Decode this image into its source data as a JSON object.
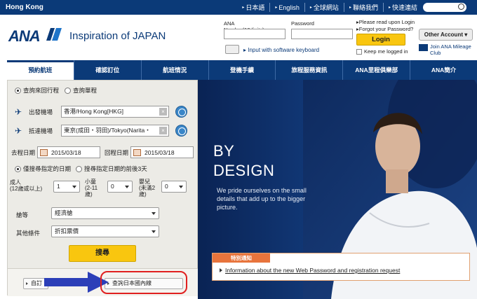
{
  "topbar": {
    "region": "Hong Kong",
    "links": [
      "日本語",
      "English",
      "全球網站",
      "聯絡我們",
      "快速連結"
    ]
  },
  "brand": {
    "logo": "ANA",
    "tagline": "Inspiration of JAPAN"
  },
  "login": {
    "ana_number_label": "ANA Number(10digits)",
    "password_label": "Password",
    "keyboard_link": "Input with software keyboard",
    "please_read": "Please read upon Login",
    "forgot": "Forgot your Password?",
    "login_button": "Login",
    "keep_logged_in": "Keep me logged in",
    "other_account": "Other Account",
    "join": "Join ANA Mileage Club"
  },
  "nav": [
    "預約航班",
    "確認訂位",
    "航班情況",
    "登機手續",
    "旅程服務資訊",
    "ANA里程俱樂部",
    "ANA簡介"
  ],
  "booking": {
    "trip_types": [
      "查詢來回行程",
      "查詢單程"
    ],
    "departure_label": "出發機場",
    "departure_value": "香港/Hong Kong[HKG]",
    "arrival_label": "抵達機場",
    "arrival_value": "東京(成田・羽田)/Tokyo(Narita・",
    "depart_date_label": "去程日期",
    "depart_date": "2015/03/18",
    "return_date_label": "回程日期",
    "return_date": "2015/03/18",
    "date_options": [
      "僅搜尋指定的日期",
      "搜尋指定日期的前後3天"
    ],
    "adult_label": "成人\n(12歲或以上)",
    "adult_value": "1",
    "child_label": "小童\n(2-11\n歲)",
    "child_value": "0",
    "infant_label": "嬰兒\n(未滿2\n歲)",
    "infant_value": "0",
    "cabin_label": "艙等",
    "cabin_value": "經濟艙",
    "conditions_label": "其他條件",
    "conditions_value": "折扣票價",
    "search_button": "搜尋",
    "bottom_left_button": "自訂",
    "domestic_button": "查詢日本國內線"
  },
  "hero": {
    "title_line1": "BY",
    "title_line2": "DESIGN",
    "subtitle": "We pride ourselves on the small details that add up to the bigger picture."
  },
  "notice": {
    "tab": "特別通知",
    "text": "Information about the new Web Password and registration request"
  }
}
